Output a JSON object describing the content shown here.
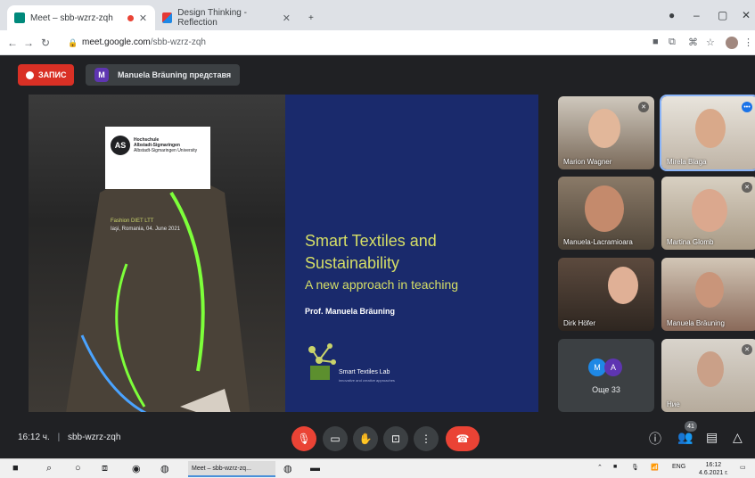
{
  "browser": {
    "tabs": [
      {
        "title": "Meet – sbb-wzrz-zqh",
        "active": true,
        "recording": true
      },
      {
        "title": "Design Thinking - Reflection",
        "active": false
      }
    ],
    "new_tab": "+",
    "url_host": "meet.google.com",
    "url_path": "/sbb-wzrz-zqh"
  },
  "meeting": {
    "record_label": "ЗАПИС",
    "presenter_initial": "M",
    "presenting_text": "Manuela Bräuning представя",
    "time": "16:12 ч.",
    "code": "sbb-wzrz-zqh",
    "participant_count": "41"
  },
  "slide": {
    "logo_mark": "AS",
    "logo_lines": [
      "Hochschule",
      "Albstadt-Sigmaringen",
      "Albstadt-Sigmaringen University"
    ],
    "caption_line1": "Fashion DIET LTT",
    "caption_line2": "Iaşi, Romania, 04. June 2021",
    "title_line1": "Smart Textiles and",
    "title_line2": "Sustainability",
    "subtitle": "A new approach in teaching",
    "author": "Prof. Manuela Bräuning",
    "lab_name": "Smart Textiles Lab",
    "lab_tagline": "innovative and creative approaches"
  },
  "participants": [
    {
      "name": "Marion Wagner",
      "speaking": false
    },
    {
      "name": "Mirela Blaga",
      "speaking": true
    },
    {
      "name": "Manuela-Lacramioara",
      "speaking": false
    },
    {
      "name": "Martina Glomb",
      "speaking": false
    },
    {
      "name": "Dirk Höfer",
      "speaking": false
    },
    {
      "name": "Manuela Bräuning",
      "speaking": false
    },
    {
      "name": "Ние",
      "speaking": false
    }
  ],
  "others": {
    "initials": [
      "M",
      "A"
    ],
    "label": "Още 33",
    "colors": [
      "#1e88e5",
      "#5e35b1"
    ]
  },
  "taskbar": {
    "app_label": "Meet – sbb-wzrz-zq...",
    "lang": "ENG",
    "clock": "16:12",
    "date": "4.6.2021 г."
  },
  "colors": {
    "accent_red": "#ea4335",
    "slide_blue": "#1a2a6c",
    "slide_yellow": "#d6df66"
  }
}
